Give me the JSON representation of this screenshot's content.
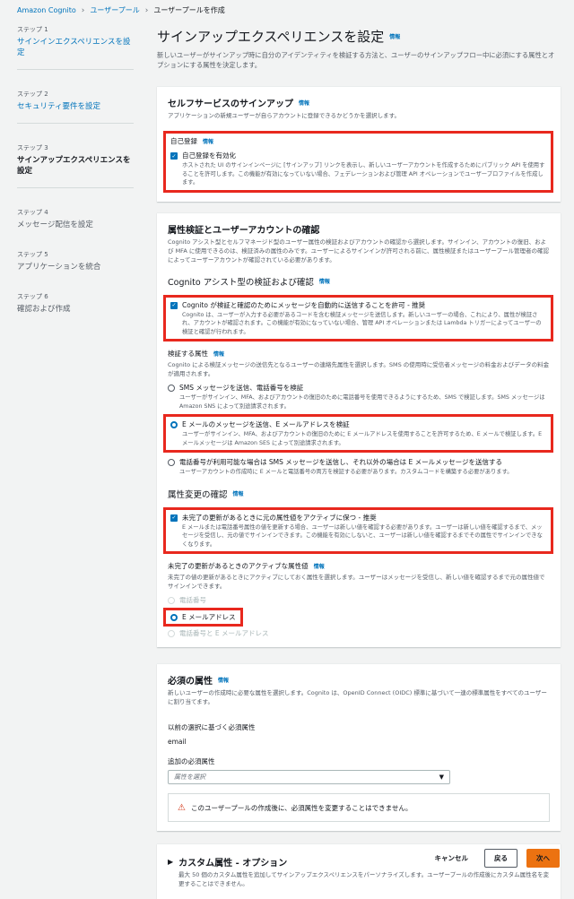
{
  "breadcrumb": [
    "Amazon Cognito",
    "ユーザープール",
    "ユーザープールを作成"
  ],
  "steps": [
    {
      "num": "ステップ 1",
      "label": "サインインエクスペリエンスを設定",
      "active": false
    },
    {
      "num": "ステップ 2",
      "label": "セキュリティ要件を設定",
      "active": false
    },
    {
      "num": "ステップ 3",
      "label": "サインアップエクスペリエンスを設定",
      "active": true
    },
    {
      "num": "ステップ 4",
      "label": "メッセージ配信を設定",
      "active": false
    },
    {
      "num": "ステップ 5",
      "label": "アプリケーションを統合",
      "active": false
    },
    {
      "num": "ステップ 6",
      "label": "確認および作成",
      "active": false
    }
  ],
  "info": "情報",
  "page": {
    "title": "サインアップエクスペリエンスを設定",
    "desc": "新しいユーザーがサインアップ時に自分のアイデンティティを検証する方法と、ユーザーのサインアップフロー中に必須にする属性とオプションにする属性を決定します。"
  },
  "self_service": {
    "title": "セルフサービスのサインアップ",
    "desc": "アプリケーションの新規ユーザーが自らアカウントに登録できるかどうかを選択します。",
    "label": "自己登録",
    "check_label": "自己登録を有効化",
    "check_desc": "ホストされた UI のサインインページに [サインアップ] リンクを表示し、新しいユーザーアカウントを作成するためにパブリック API を使用することを許可します。この機能が有効になっていない場合、フェデレーションおよび管理 API オペレーションでユーザープロファイルを作成します。"
  },
  "verification": {
    "title": "属性検証とユーザーアカウントの確認",
    "desc": "Cognito アシスト型とセルフマネージド型のユーザー属性の検証およびアカウントの確認から選択します。サインイン、アカウントの復旧、および MFA に使用できるのは、検証済みの属性のみです。ユーザーによるサインインが許可される前に、属性検証またはユーザープール管理者の確認によってユーザーアカウントが確認されている必要があります。",
    "cognito_title": "Cognito アシスト型の検証および確認",
    "auto_label": "Cognito が検証と確認のためにメッセージを自動的に送信することを許可 - 推奨",
    "auto_desc": "Cognito は、ユーザーが入力する必要があるコードを含む検証メッセージを送信します。新しいユーザーの場合、これにより、属性が検証され、アカウントが確認されます。この機能が有効になっていない場合、管理 API オペレーションまたは Lambda トリガーによってユーザーの検証と確認が行われます。",
    "attr_label": "検証する属性",
    "attr_desc": "Cognito による検証メッセージの送信先となるユーザーの連絡先属性を選択します。SMS の使用時に受信者メッセージの料金およびデータの料金が適用されます。",
    "options": [
      {
        "t": "SMS メッセージを送信、電話番号を検証",
        "d": "ユーザーがサインイン、MFA、およびアカウントの復旧のために電話番号を使用できるようにするため、SMS で検証します。SMS メッセージは Amazon SNS によって別途請求されます。"
      },
      {
        "t": "E メールのメッセージを送信、E メールアドレスを検証",
        "d": "ユーザーがサインイン、MFA、およびアカウントの復旧のために E メールアドレスを使用することを許可するため、E メールで検証します。E メールメッセージは Amazon SES によって別途請求されます。"
      },
      {
        "t": "電話番号が利用可能な場合は SMS メッセージを送信し、それ以外の場合は E メールメッセージを送信する",
        "d": "ユーザーアカウントの作成時に E メールと電話番号の両方を検証する必要があります。カスタムコードを構築する必要があります。"
      }
    ],
    "change_title": "属性変更の確認",
    "keep_label": "未完了の更新があるときに元の属性値をアクティブに保つ - 推奨",
    "keep_desc": "E メールまたは電話番号属性の値を更新する場合、ユーザーは新しい値を確認する必要があります。ユーザーは新しい値を確認するまで、メッセージを受信し、元の値でサインインできます。この機能を有効にしないと、ユーザーは新しい値を確認するまでその属性でサインインできなくなります。",
    "active_label": "未完了の更新があるときのアクティブな属性値",
    "active_desc": "未完了の値の更新があるときにアクティブにしておく属性を選択します。ユーザーはメッセージを受信し、新しい値を確認するまで元の属性値でサインインできます。",
    "active_options": [
      "電話番号",
      "E メールアドレス",
      "電話番号と E メールアドレス"
    ]
  },
  "required": {
    "title": "必須の属性",
    "desc": "新しいユーザーの作成時に必要な属性を選択します。Cognito は、OpenID Connect (OIDC) 標準に基づいて一連の標準属性をすべてのユーザーに割り当てます。",
    "prev_label": "以前の選択に基づく必須属性",
    "prev_value": "email",
    "add_label": "追加の必須属性",
    "select_placeholder": "属性を選択",
    "alert": "このユーザープールの作成後に、必須属性を変更することはできません。"
  },
  "custom": {
    "title": "カスタム属性 - オプション",
    "desc": "最大 50 個のカスタム属性を追加してサインアップエクスペリエンスをパーソナライズします。ユーザープールの作成後にカスタム属性名を変更することはできません。"
  },
  "footer": {
    "cancel": "キャンセル",
    "back": "戻る",
    "next": "次へ"
  }
}
